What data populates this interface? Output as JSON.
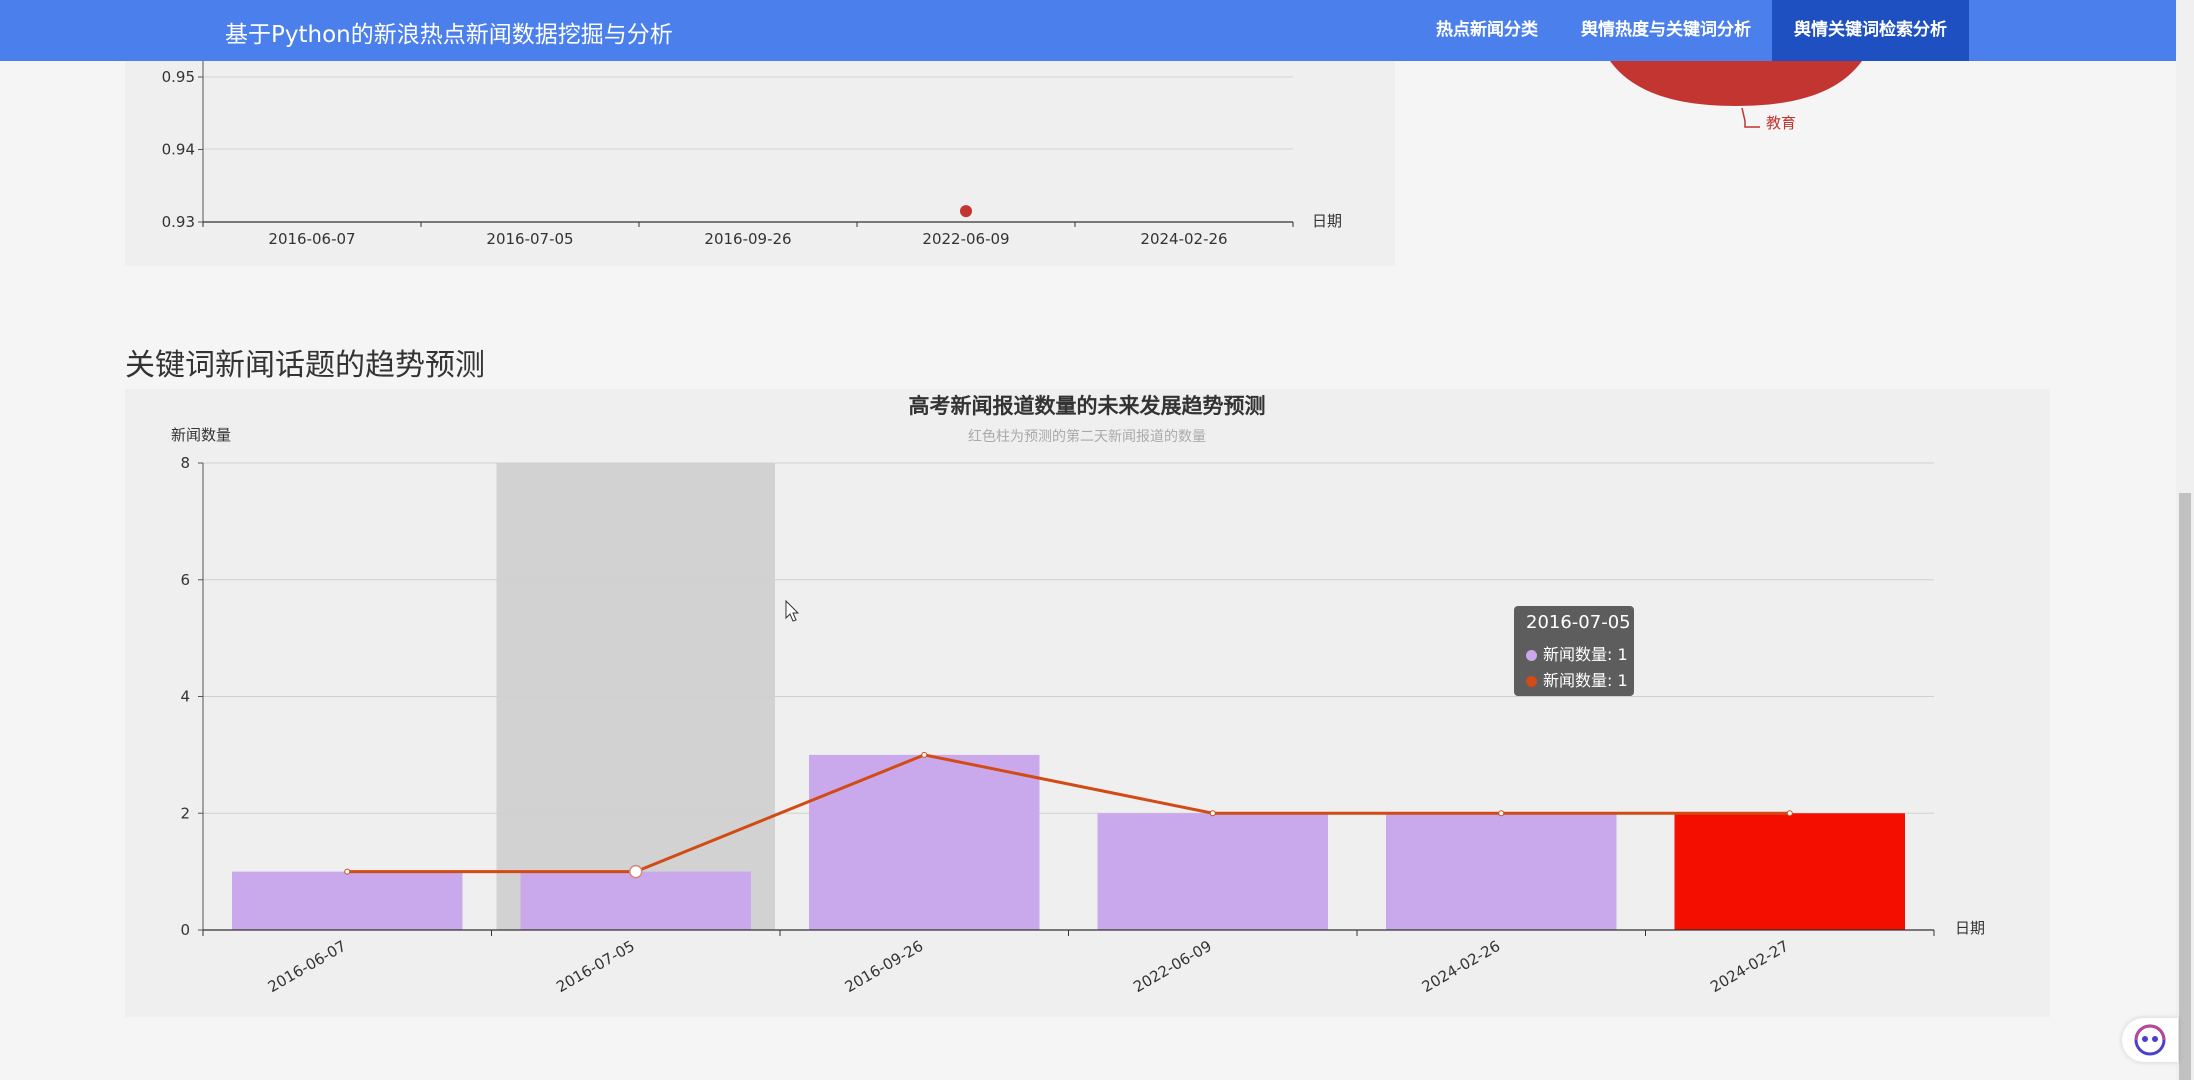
{
  "app": {
    "title": "基于Python的新浪热点新闻数据挖掘与分析",
    "nav": [
      {
        "label": "热点新闻分类",
        "active": false
      },
      {
        "label": "舆情热度与关键词分析",
        "active": false
      },
      {
        "label": "舆情关键词检索分析",
        "active": true
      }
    ]
  },
  "pie_fragment": {
    "label": "教育",
    "color": "#c23531"
  },
  "top_chart": {
    "y_ticks": [
      "0.95",
      "0.94",
      "0.93"
    ],
    "x_ticks": [
      "2016-06-07",
      "2016-07-05",
      "2016-09-26",
      "2022-06-09",
      "2024-02-26"
    ],
    "x_name": "日期"
  },
  "section": {
    "title": "关键词新闻话题的趋势预测"
  },
  "chart_data": [
    {
      "type": "scatter",
      "categories": [
        "2016-06-07",
        "2016-07-05",
        "2016-09-26",
        "2022-06-09",
        "2024-02-26"
      ],
      "points": [
        {
          "x": "2022-06-09",
          "y": 0.9315
        }
      ],
      "xlabel": "日期",
      "ylim": [
        0.93,
        0.95
      ],
      "color": "#c23531"
    },
    {
      "type": "bar",
      "title": "高考新闻报道数量的未来发展趋势预测",
      "subtitle": "红色柱为预测的第二天新闻报道的数量",
      "ylabel": "新闻数量",
      "xlabel": "日期",
      "categories": [
        "2016-06-07",
        "2016-07-05",
        "2016-09-26",
        "2022-06-09",
        "2024-02-26",
        "2024-02-27"
      ],
      "ylim": [
        0,
        8
      ],
      "yticks": [
        "0",
        "2",
        "4",
        "6",
        "8"
      ],
      "series": [
        {
          "name": "新闻数量",
          "type": "bar",
          "values": [
            1,
            1,
            3,
            2,
            2,
            2
          ],
          "color": "#c9a8ec",
          "predicted_color": "#f40e00"
        },
        {
          "name": "新闻数量",
          "type": "line",
          "values": [
            1,
            1,
            3,
            2,
            2,
            2
          ],
          "color": "#d24a14"
        }
      ],
      "highlight_category": "2016-07-05",
      "grid": true
    }
  ],
  "tooltip": {
    "title": "2016-07-05",
    "rows": [
      {
        "text": "新闻数量: 1",
        "color": "#c9a8ec"
      },
      {
        "text": "新闻数量: 1",
        "color": "#d24a14"
      }
    ]
  }
}
